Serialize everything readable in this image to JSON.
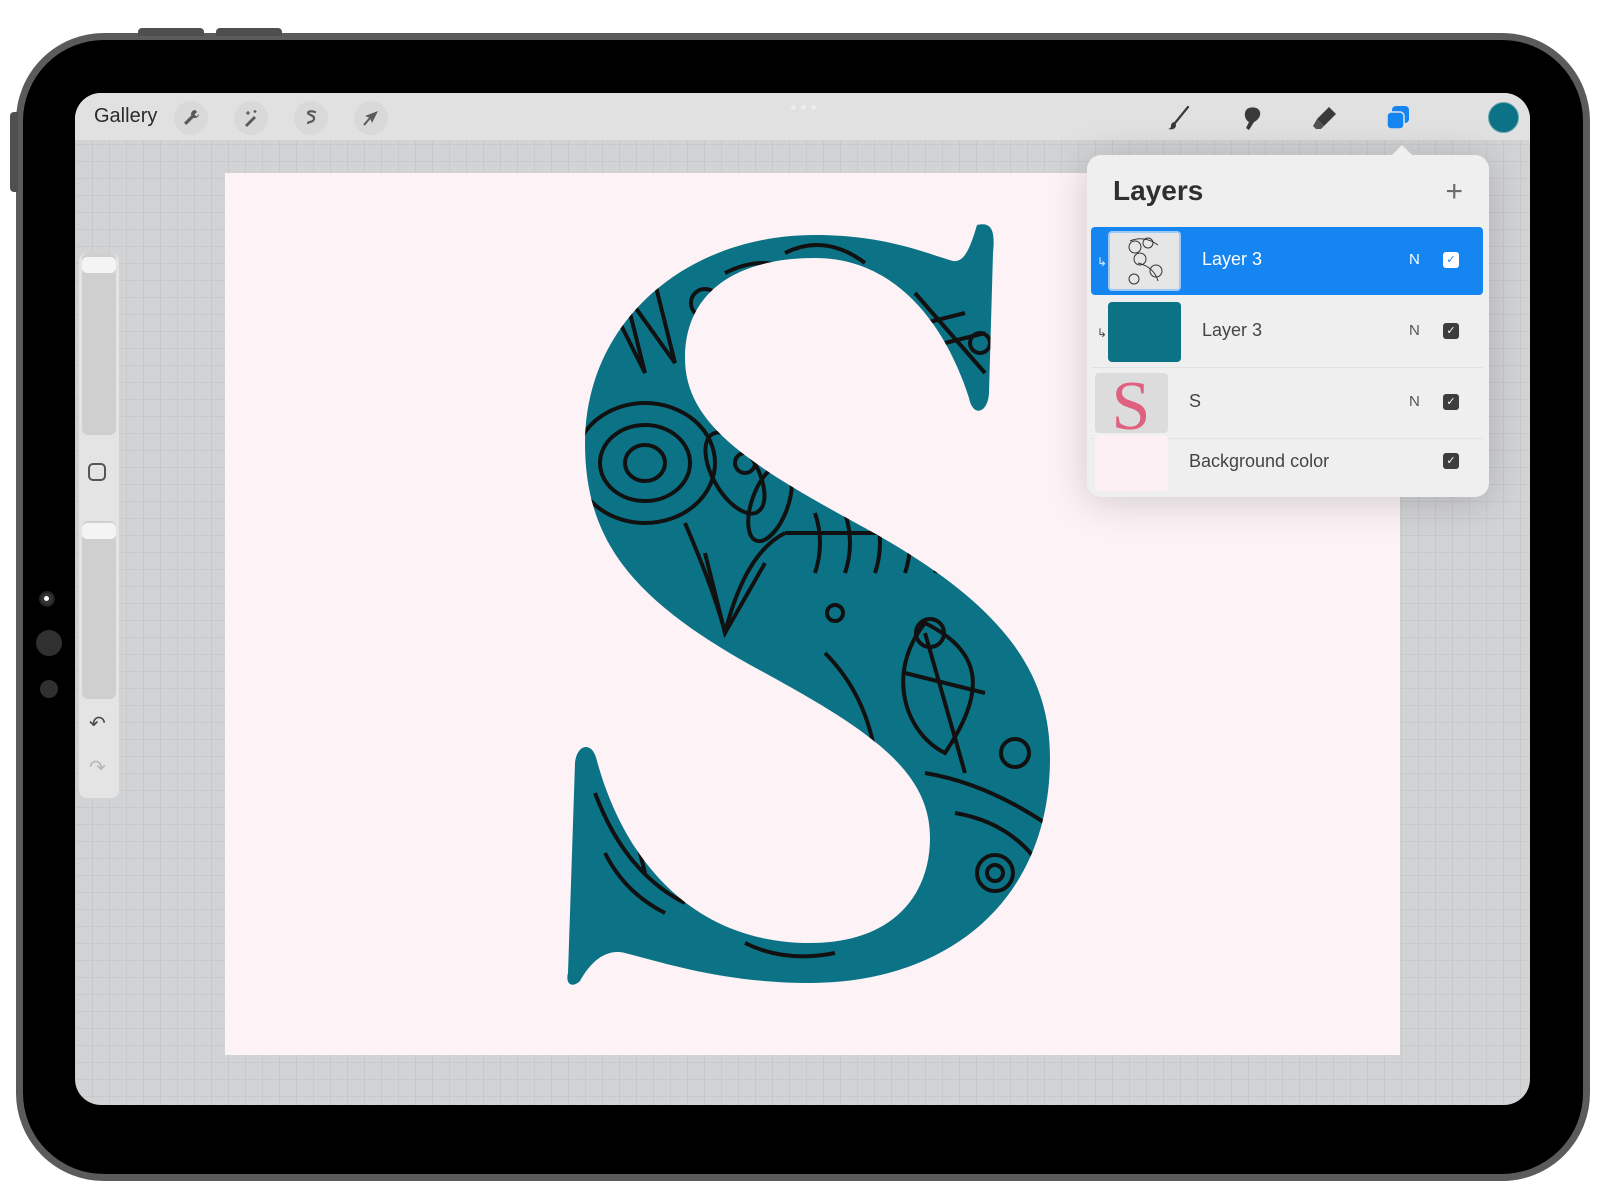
{
  "toolbar": {
    "gallery_label": "Gallery",
    "left_tools": [
      {
        "name": "actions",
        "icon": "wrench-icon"
      },
      {
        "name": "adjustments",
        "icon": "magic-wand-icon"
      },
      {
        "name": "selection",
        "icon": "selection-s-icon"
      },
      {
        "name": "transform",
        "icon": "arrow-cursor-icon"
      }
    ],
    "right_tools": [
      {
        "name": "brush",
        "icon": "brush-icon"
      },
      {
        "name": "smudge",
        "icon": "smudge-finger-icon"
      },
      {
        "name": "eraser",
        "icon": "eraser-icon"
      },
      {
        "name": "layers",
        "icon": "layers-icon",
        "active": true
      }
    ],
    "active_color": "#0c7386",
    "accent_color": "#1585f2"
  },
  "sidebar": {
    "brush_size_icon": "slider-handle",
    "modify_icon": "square-icon",
    "undo_icon": "↶",
    "redo_icon": "↷"
  },
  "canvas": {
    "background_color": "#fdf3f7",
    "letter": "S",
    "letter_fill": "#0c7386",
    "pattern_stroke": "#111111"
  },
  "layers_panel": {
    "title": "Layers",
    "add_icon": "+",
    "layers": [
      {
        "name": "Layer 3",
        "blend": "N",
        "visible": true,
        "selected": true,
        "clipped": true,
        "thumb": "floral-pattern"
      },
      {
        "name": "Layer 3",
        "blend": "N",
        "visible": true,
        "selected": false,
        "clipped": true,
        "thumb": "#0c7386"
      },
      {
        "name": "S",
        "blend": "N",
        "visible": true,
        "selected": false,
        "clipped": false,
        "thumb": "pink-s"
      },
      {
        "name": "Background color",
        "blend": "",
        "visible": true,
        "selected": false,
        "clipped": false,
        "thumb": "#fdf0f5"
      }
    ],
    "check_glyph": "✓",
    "clip_glyph": "↳"
  }
}
